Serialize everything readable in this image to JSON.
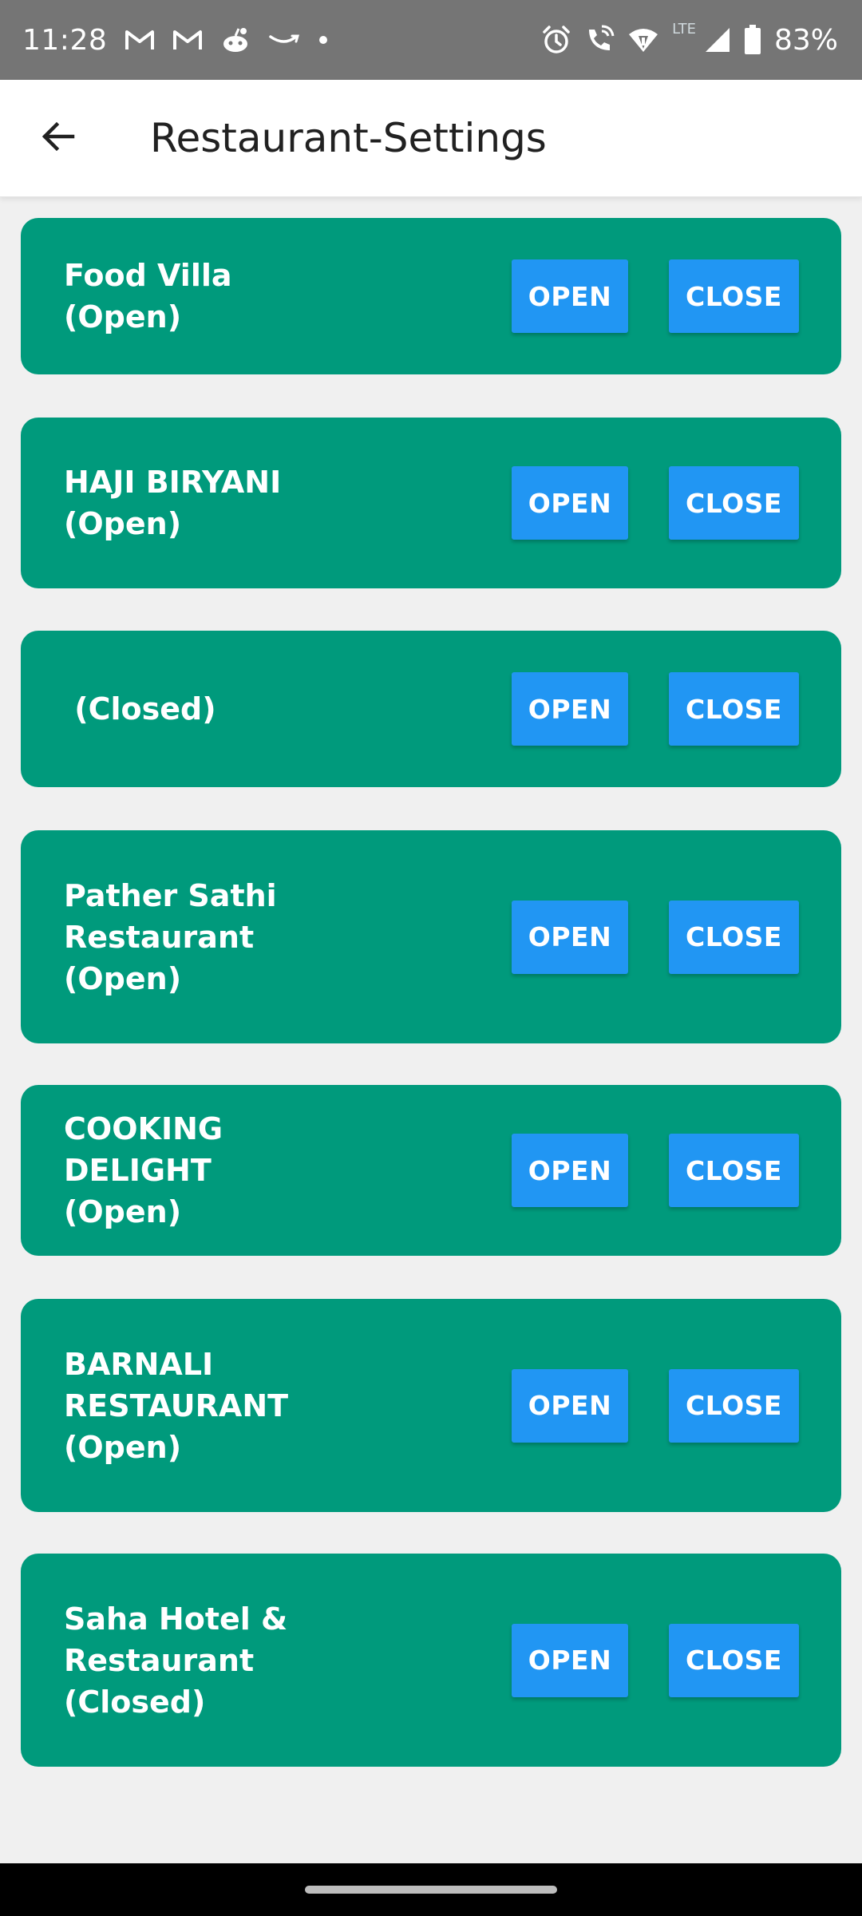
{
  "status_bar": {
    "time": "11:28",
    "battery": "83%",
    "network": "LTE",
    "icons_left": [
      "gmail-icon",
      "gmail-icon",
      "reddit-icon",
      "amazon-icon",
      "dot-icon"
    ],
    "icons_right": [
      "alarm-icon",
      "wifi-call-icon",
      "wifi-icon",
      "signal-icon",
      "battery-icon"
    ]
  },
  "app_bar": {
    "title": "Restaurant-Settings",
    "back_icon": "arrow-left-icon"
  },
  "colors": {
    "card_bg": "#009a7c",
    "button_bg": "#2196f3",
    "page_bg": "#f0f0f0",
    "status_bar_bg": "#757575"
  },
  "restaurants": [
    {
      "label": "Food Villa (Open)",
      "open_label": "OPEN",
      "close_label": "CLOSE"
    },
    {
      "label": "HAJI BIRYANI (Open)",
      "open_label": "OPEN",
      "close_label": "CLOSE"
    },
    {
      "label": " (Closed)",
      "open_label": "OPEN",
      "close_label": "CLOSE"
    },
    {
      "label": "Pather Sathi Restaurant (Open)",
      "open_label": "OPEN",
      "close_label": "CLOSE"
    },
    {
      "label": "COOKING DELIGHT (Open)",
      "open_label": "OPEN",
      "close_label": "CLOSE"
    },
    {
      "label": "BARNALI RESTAURANT (Open)",
      "open_label": "OPEN",
      "close_label": "CLOSE"
    },
    {
      "label": "Saha Hotel & Restaurant (Closed)",
      "open_label": "OPEN",
      "close_label": "CLOSE"
    }
  ]
}
